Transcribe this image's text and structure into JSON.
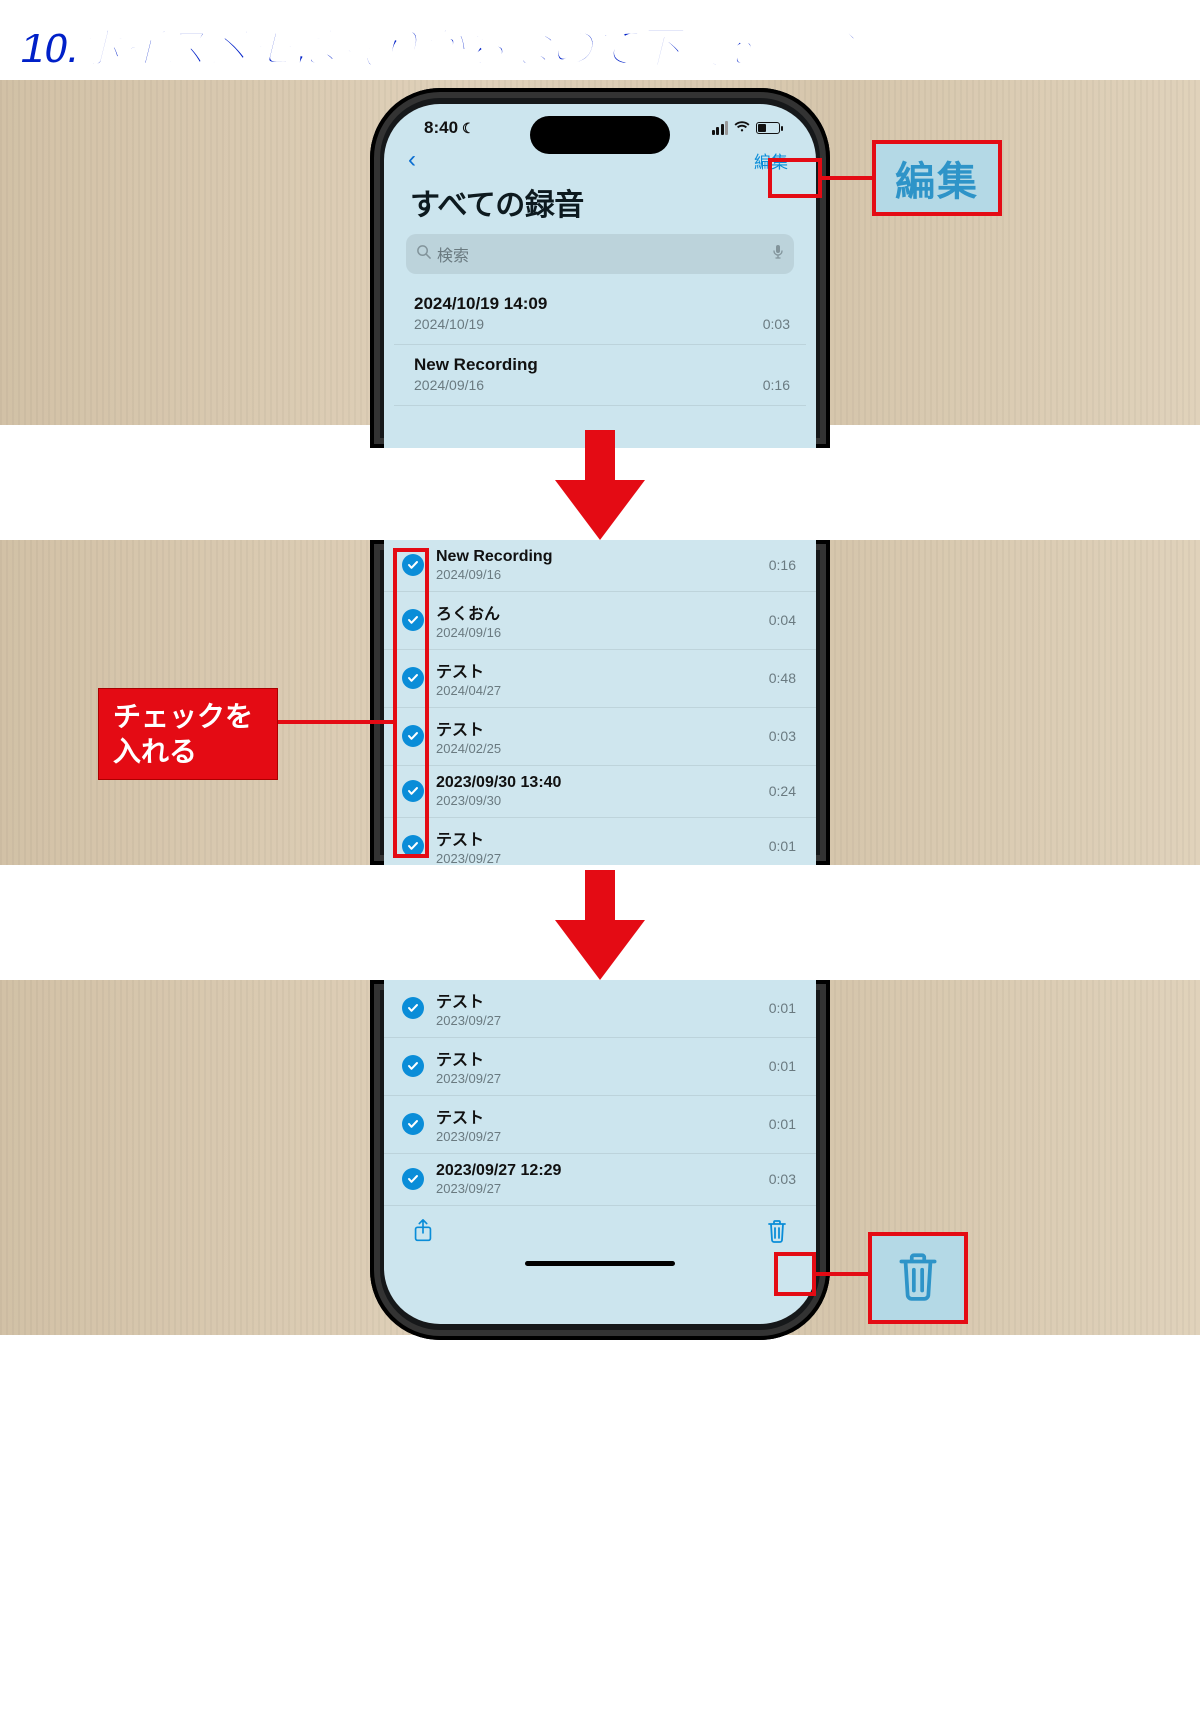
{
  "main_heading": "10.ボイスメモは残りがちなので不要を削除",
  "status": {
    "time": "8:40"
  },
  "nav": {
    "edit_label": "編集",
    "screen_title": "すべての録音",
    "search_placeholder": "検索"
  },
  "panel1_recordings": [
    {
      "title": "2024/10/19 14:09",
      "date": "2024/10/19",
      "duration": "0:03"
    },
    {
      "title": "New Recording",
      "date": "2024/09/16",
      "duration": "0:16"
    }
  ],
  "panel2_recordings": [
    {
      "title": "New Recording",
      "date": "2024/09/16",
      "duration": "0:16"
    },
    {
      "title": "ろくおん",
      "date": "2024/09/16",
      "duration": "0:04"
    },
    {
      "title": "テスト",
      "date": "2024/04/27",
      "duration": "0:48"
    },
    {
      "title": "テスト",
      "date": "2024/02/25",
      "duration": "0:03"
    },
    {
      "title": "2023/09/30 13:40",
      "date": "2023/09/30",
      "duration": "0:24"
    },
    {
      "title": "テスト",
      "date": "2023/09/27",
      "duration": "0:01"
    }
  ],
  "panel3_recordings": [
    {
      "title": "テスト",
      "date": "2023/09/27",
      "duration": "0:01"
    },
    {
      "title": "テスト",
      "date": "2023/09/27",
      "duration": "0:01"
    },
    {
      "title": "テスト",
      "date": "2023/09/27",
      "duration": "0:01"
    },
    {
      "title": "2023/09/27 12:29",
      "date": "2023/09/27",
      "duration": "0:03"
    }
  ],
  "callouts": {
    "edit_zoom": "編集",
    "check_label": "チェックを\n入れる"
  }
}
